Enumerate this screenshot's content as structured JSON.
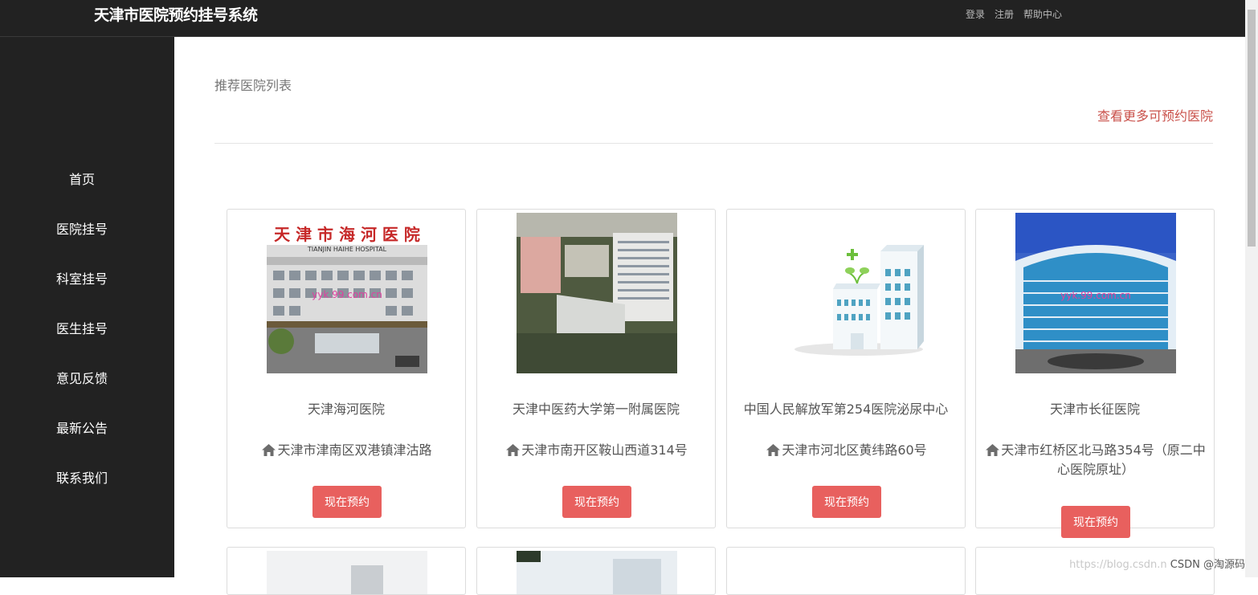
{
  "header": {
    "brand": "天津市医院预约挂号系统",
    "links": [
      "登录",
      "注册",
      "帮助中心"
    ]
  },
  "sidebar": {
    "items": [
      "首页",
      "医院挂号",
      "科室挂号",
      "医生挂号",
      "意见反馈",
      "最新公告",
      "联系我们"
    ]
  },
  "main": {
    "section_title": "推荐医院列表",
    "more_link": "查看更多可预约医院",
    "button_label": "现在预约",
    "hospitals": [
      {
        "name": "天津海河医院",
        "address": "天津市津南区双港镇津沽路",
        "photo_text": "天 津 市 海 河 医 院",
        "photo_subtext": "TIANJIN HAIHE HOSPITAL",
        "photo_watermark": "yyk.99.com.cn"
      },
      {
        "name": "天津中医药大学第一附属医院",
        "address": "天津市南开区鞍山西道314号"
      },
      {
        "name": "中国人民解放军第254医院泌尿中心",
        "address": "天津市河北区黄纬路60号"
      },
      {
        "name": "天津市长征医院",
        "address": "天津市红桥区北马路354号（原二中心医院原址）",
        "photo_watermark": "yyk.99.com.cn"
      }
    ]
  },
  "watermark": {
    "url": "https://blog.csdn.n",
    "text": "CSDN @淘源码"
  },
  "colors": {
    "bar": "#222222",
    "accent": "#e8605e",
    "link": "#c9504a"
  }
}
